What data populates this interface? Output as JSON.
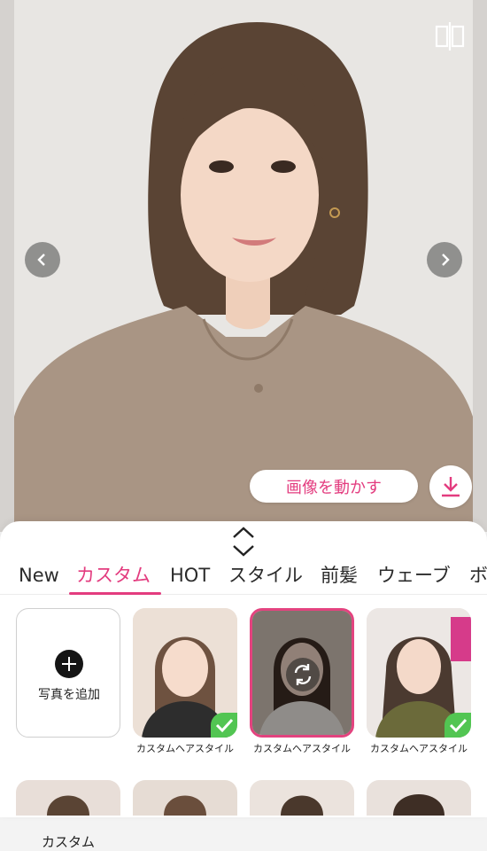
{
  "move_button_label": "画像を動かす",
  "tabs": [
    "New",
    "カスタム",
    "HOT",
    "スタイル",
    "前髪",
    "ウェーブ",
    "ボ"
  ],
  "active_tab": "カスタム",
  "add_photo_label": "写真を追加",
  "custom_caption": "カスタム",
  "style_captions": [
    "カスタムヘアスタイル",
    "カスタムヘアスタイル",
    "カスタムヘアスタイル"
  ],
  "colors": {
    "accent": "#e33c7f",
    "check": "#52c552"
  },
  "icons": [
    "compare-split-icon",
    "chevron-left-icon",
    "chevron-right-icon",
    "download-icon",
    "expand-collapse-icon",
    "plus-icon",
    "swap-icon",
    "checkmark-icon"
  ]
}
